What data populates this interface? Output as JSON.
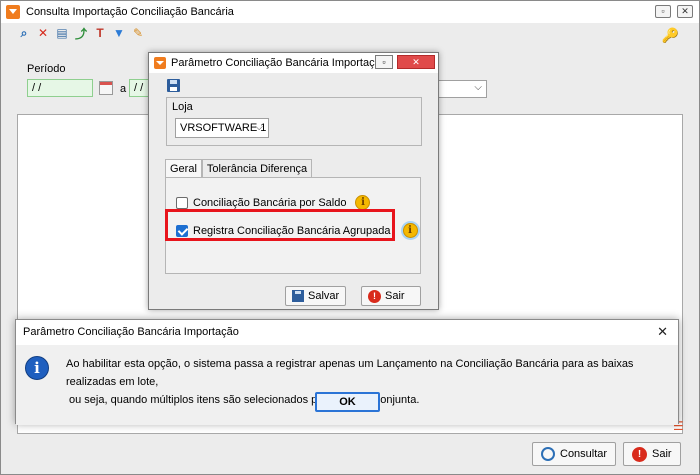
{
  "main_window": {
    "title": "Consulta Importação Conciliação Bancária",
    "toolbar_icons": [
      "search-icon",
      "delete-icon",
      "print-icon",
      "export-icon",
      "text-icon",
      "filter-icon",
      "edit-icon"
    ],
    "period_label": "Período",
    "date_from": "/ /",
    "date_to": "/ /",
    "a_label": "a",
    "buttons": {
      "consultar": "Consultar",
      "sair": "Sair"
    }
  },
  "param_dialog": {
    "title": "Parâmetro Conciliação Bancária Importação",
    "loja_label": "Loja",
    "loja_value": "VRSOFTWARE 1",
    "tabs": [
      "Geral",
      "Tolerância Diferença"
    ],
    "options": [
      {
        "label": "Conciliação Bancária por Saldo",
        "checked": false
      },
      {
        "label": "Registra Conciliação Bancária Agrupada",
        "checked": true
      }
    ],
    "info_glyph": "i",
    "buttons": {
      "salvar": "Salvar",
      "sair": "Sair"
    },
    "highlight_color": "#e8141c"
  },
  "message_box": {
    "title": "Parâmetro Conciliação Bancária Importação",
    "line1": "Ao habilitar esta opção, o sistema passa a registrar apenas um Lançamento na Conciliação Bancária para as baixas realizadas em lote,",
    "line2": "ou seja, quando múltiplos itens são selecionados para a baixa conjunta.",
    "ok_label": "OK",
    "close_glyph": "✕",
    "info_glyph": "i"
  },
  "colors": {
    "accent_orange": "#f07c1e",
    "checkbox_blue": "#1d6fd1",
    "info_yellow": "#f5b800",
    "stop_red": "#d92b1c"
  }
}
